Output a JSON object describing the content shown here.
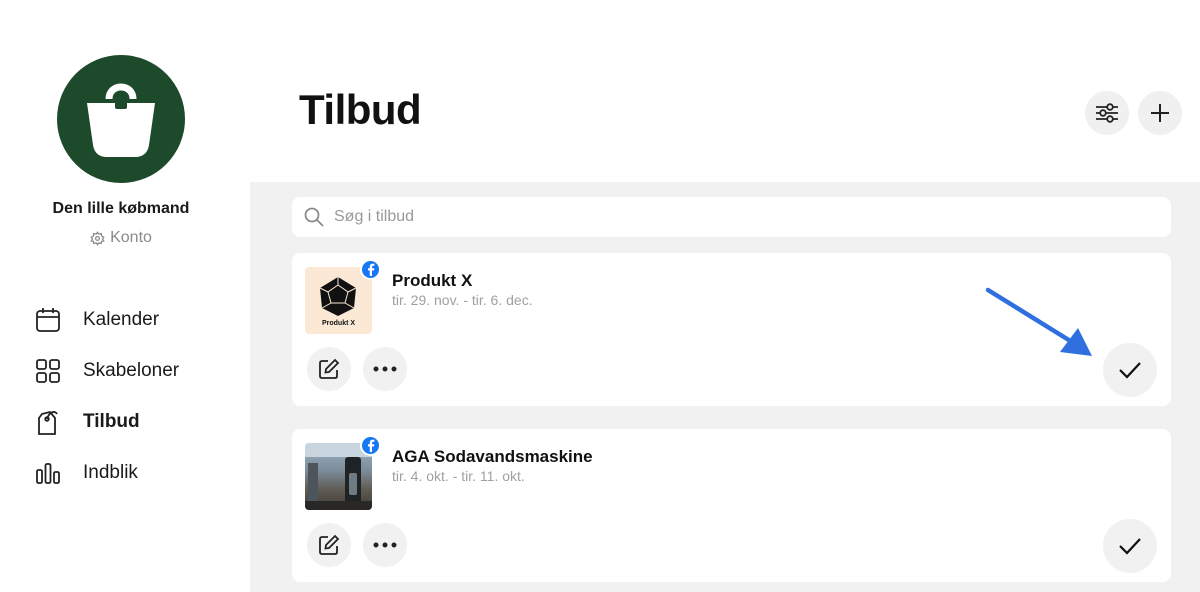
{
  "sidebar": {
    "store_name": "Den lille købmand",
    "account_label": "Konto",
    "nav": [
      {
        "label": "Kalender",
        "icon": "calendar-icon",
        "active": false
      },
      {
        "label": "Skabeloner",
        "icon": "templates-grid-icon",
        "active": false
      },
      {
        "label": "Tilbud",
        "icon": "price-tag-icon",
        "active": true
      },
      {
        "label": "Indblik",
        "icon": "bar-chart-icon",
        "active": false
      }
    ]
  },
  "header": {
    "title": "Tilbud",
    "filter_icon": "sliders-icon",
    "add_icon": "plus-icon"
  },
  "search": {
    "placeholder": "Søg i tilbud",
    "value": ""
  },
  "offers": [
    {
      "title": "Produkt X",
      "dates": "tir. 29. nov. - tir. 6. dec.",
      "thumb_label": "Produkt X",
      "channel": "facebook-icon"
    },
    {
      "title": "AGA Sodavandsmaskine",
      "dates": "tir. 4. okt. - tir. 11. okt.",
      "channel": "facebook-icon"
    }
  ],
  "colors": {
    "brand": "#1d4a2a",
    "panel": "#f1f1f1",
    "facebook": "#1877f2",
    "arrow": "#2f6fe0"
  }
}
